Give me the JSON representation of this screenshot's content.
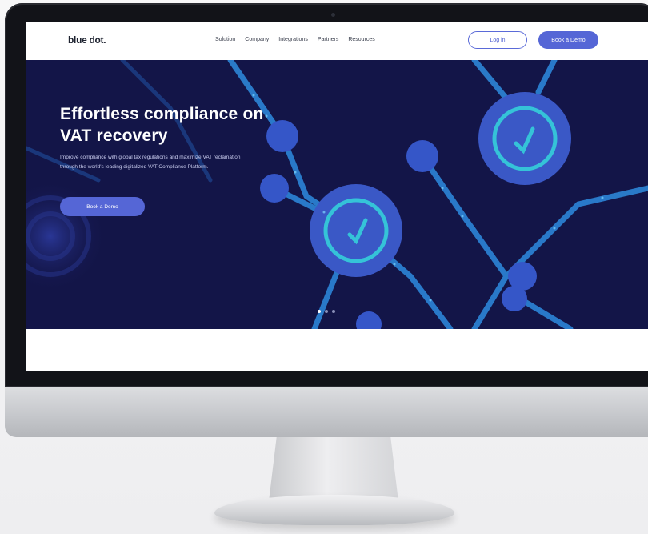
{
  "site": {
    "logo": "blue dot.",
    "nav": [
      "Solution",
      "Company",
      "Integrations",
      "Partners",
      "Resources"
    ],
    "login_label": "Log in",
    "demo_label": "Book a Demo"
  },
  "hero": {
    "title_line1": "Effortless compliance on",
    "title_line2": "VAT recovery",
    "subtitle": "Improve compliance with global tax regulations and maximize VAT reclamation through the world's leading digitalized VAT Compliance Platform.",
    "cta_label": "Book a Demo",
    "slides_total": 3,
    "slide_active": 1
  },
  "colors": {
    "hero_background": "#131548",
    "accent": "#5566d6",
    "node_fill": "#3b55c8",
    "check_ring": "#2fc4d6"
  }
}
